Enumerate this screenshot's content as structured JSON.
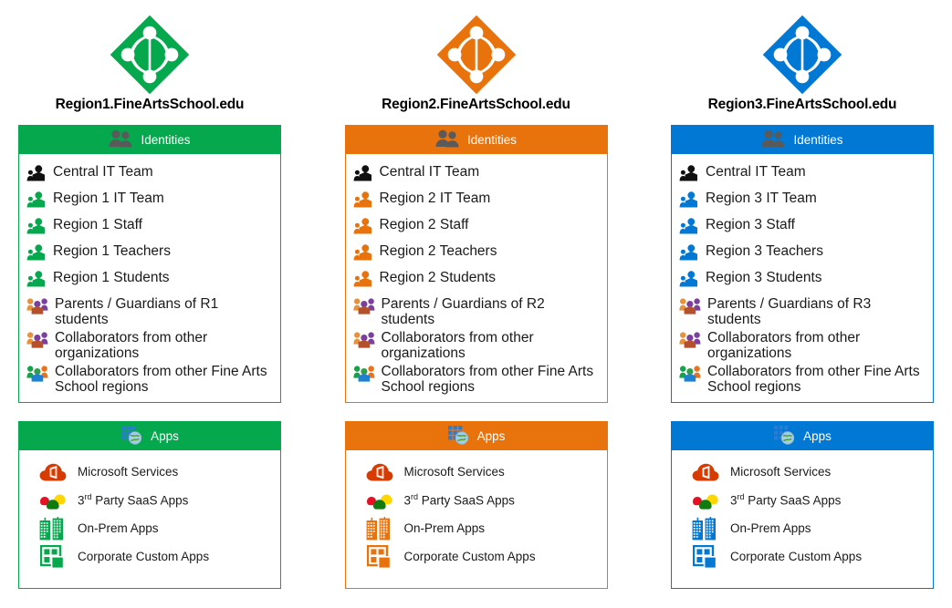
{
  "colors": {
    "green": "#06A84E",
    "orange": "#E8730C",
    "blue": "#0078D4",
    "icon_dark": "#595959",
    "black": "#1a1a1a"
  },
  "columns": [
    {
      "accent": "#06A84E",
      "logo_icon": "azure-ad-logo",
      "title": "Region1.FineArtsSchool.edu",
      "identities": {
        "header_icon": "people-icon",
        "header_label": "Identities",
        "items": [
          {
            "label": "Central IT Team",
            "icon": "person-group-black-icon"
          },
          {
            "label": "Region 1 IT Team",
            "icon": "person-group-accent-icon"
          },
          {
            "label": "Region 1 Staff",
            "icon": "person-group-accent-icon"
          },
          {
            "label": "Region 1 Teachers",
            "icon": "person-group-accent-icon"
          },
          {
            "label": "Region 1 Students",
            "icon": "person-group-accent-icon"
          },
          {
            "label": "Parents / Guardians of R1 students",
            "icon": "external-people-orange-purple-icon"
          },
          {
            "label": "Collaborators from other organizations",
            "icon": "external-people-orange-purple-icon"
          },
          {
            "label": "Collaborators from other Fine Arts School regions",
            "icon": "external-people-multicolor-icon"
          }
        ]
      },
      "apps": {
        "header_icon": "apps-globe-icon",
        "header_label": "Apps",
        "items": [
          {
            "label": "Microsoft Services",
            "icon": "office-cloud-icon"
          },
          {
            "label": "3rd Party SaaS Apps",
            "label_prefix": "3",
            "label_sup": "rd",
            "label_rest": " Party SaaS Apps",
            "icon": "saas-clouds-icon"
          },
          {
            "label": "On-Prem Apps",
            "icon": "on-prem-buildings-icon"
          },
          {
            "label": "Corporate Custom Apps",
            "icon": "custom-apps-window-icon"
          }
        ]
      }
    },
    {
      "accent": "#E8730C",
      "logo_icon": "azure-ad-logo",
      "title": "Region2.FineArtsSchool.edu",
      "identities": {
        "header_icon": "people-icon",
        "header_label": "Identities",
        "items": [
          {
            "label": "Central IT Team",
            "icon": "person-group-black-icon"
          },
          {
            "label": "Region 2 IT Team",
            "icon": "person-group-accent-icon"
          },
          {
            "label": "Region 2 Staff",
            "icon": "person-group-accent-icon"
          },
          {
            "label": "Region 2 Teachers",
            "icon": "person-group-accent-icon"
          },
          {
            "label": "Region 2 Students",
            "icon": "person-group-accent-icon"
          },
          {
            "label": "Parents / Guardians of R2 students",
            "icon": "external-people-orange-purple-icon"
          },
          {
            "label": "Collaborators from other organizations",
            "icon": "external-people-orange-purple-icon"
          },
          {
            "label": "Collaborators from other Fine Arts School regions",
            "icon": "external-people-multicolor-icon"
          }
        ]
      },
      "apps": {
        "header_icon": "apps-globe-icon",
        "header_label": "Apps",
        "items": [
          {
            "label": "Microsoft Services",
            "icon": "office-cloud-icon"
          },
          {
            "label": "3rd Party SaaS Apps",
            "label_prefix": "3",
            "label_sup": "rd",
            "label_rest": " Party SaaS Apps",
            "icon": "saas-clouds-icon"
          },
          {
            "label": "On-Prem Apps",
            "icon": "on-prem-buildings-icon"
          },
          {
            "label": "Corporate Custom Apps",
            "icon": "custom-apps-window-icon"
          }
        ]
      }
    },
    {
      "accent": "#0078D4",
      "logo_icon": "azure-ad-logo",
      "title": "Region3.FineArtsSchool.edu",
      "identities": {
        "header_icon": "people-icon",
        "header_label": "Identities",
        "items": [
          {
            "label": "Central IT Team",
            "icon": "person-group-black-icon"
          },
          {
            "label": "Region 3 IT Team",
            "icon": "person-group-accent-icon"
          },
          {
            "label": "Region 3 Staff",
            "icon": "person-group-accent-icon"
          },
          {
            "label": "Region 3 Teachers",
            "icon": "person-group-accent-icon"
          },
          {
            "label": "Region 3 Students",
            "icon": "person-group-accent-icon"
          },
          {
            "label": "Parents / Guardians of R3 students",
            "icon": "external-people-orange-purple-icon"
          },
          {
            "label": "Collaborators from other organizations",
            "icon": "external-people-orange-purple-icon"
          },
          {
            "label": "Collaborators from other Fine Arts School regions",
            "icon": "external-people-multicolor-icon"
          }
        ]
      },
      "apps": {
        "header_icon": "apps-globe-icon",
        "header_label": "Apps",
        "items": [
          {
            "label": "Microsoft Services",
            "icon": "office-cloud-icon"
          },
          {
            "label": "3rd Party SaaS Apps",
            "label_prefix": "3",
            "label_sup": "rd",
            "label_rest": " Party SaaS Apps",
            "icon": "saas-clouds-icon"
          },
          {
            "label": "On-Prem Apps",
            "icon": "on-prem-buildings-icon"
          },
          {
            "label": "Corporate Custom Apps",
            "icon": "custom-apps-window-icon"
          }
        ]
      }
    }
  ]
}
